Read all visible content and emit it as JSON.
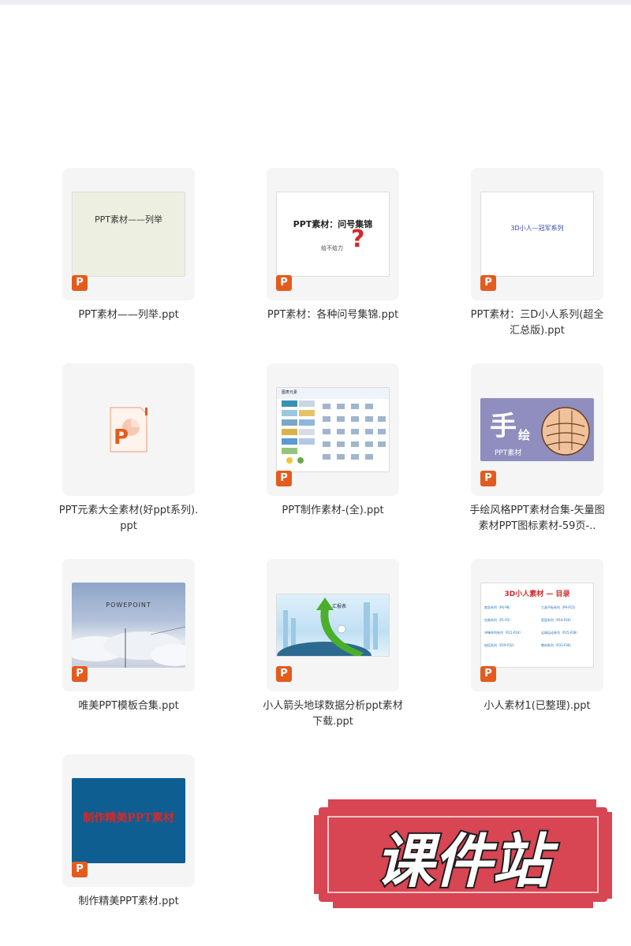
{
  "files": [
    {
      "name": "PPT素材——列举.ppt",
      "thumb_text": "PPT素材——列举",
      "badge": "P"
    },
    {
      "name": "PPT素材：各种问号集锦.ppt",
      "thumb_text": "PPT素材：问号集锦",
      "thumb_sub": "给不给力",
      "badge": "P"
    },
    {
      "name": "PPT素材：三D小人系列(超全汇总版).ppt",
      "thumb_text": "3D小人—冠军系列",
      "badge": "P"
    },
    {
      "name": "PPT元素大全素材(好ppt系列).ppt",
      "badge": "P"
    },
    {
      "name": "PPT制作素材-(全).ppt",
      "thumb_text": "图表元素",
      "badge": "P"
    },
    {
      "name": "手绘风格PPT素材合集-矢量图素材PPT图标素材-59页-..",
      "thumb_text": "手",
      "thumb_text2": "绘",
      "thumb_sub": "PPT素材",
      "badge": "P"
    },
    {
      "name": "唯美PPT模板合集.ppt",
      "thumb_text": "POWEPOINT",
      "badge": "P"
    },
    {
      "name": "小人箭头地球数据分析ppt素材下载.ppt",
      "thumb_text": "汇报表",
      "badge": "P"
    },
    {
      "name": "小人素材1(已整理).ppt",
      "thumb_text": "3D小人素材 — 目录",
      "badge": "P",
      "thumb_items": [
        "商务系列（P4-P8）",
        "工具平板系列（P9-P15）",
        "包装系列（P1-P3）",
        "家居系列（P16-P20）",
        "冲锋系列系列（P21-P24）",
        "足球运动系列（P25-P28）",
        "电话系列（P29-P32）",
        "教材系列（P33-P36）"
      ]
    },
    {
      "name": "制作精美PPT素材.ppt",
      "thumb_text": "制作精美PPT素材",
      "badge": "P"
    }
  ],
  "watermark": {
    "text": "课件站"
  },
  "colors": {
    "badge": "#e35b1e",
    "tile_bg": "#f5f5f6",
    "watermark_red": "#d84553"
  }
}
